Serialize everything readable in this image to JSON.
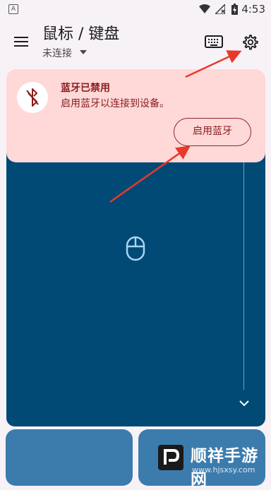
{
  "status_bar": {
    "app_badge": "A",
    "time": "4:53"
  },
  "app_bar": {
    "title": "鼠标 / 键盘",
    "subtitle": "未连接",
    "icons": [
      "menu-icon",
      "keyboard-icon",
      "gear-icon"
    ]
  },
  "banner": {
    "title": "蓝牙已禁用",
    "description": "启用蓝牙以连接到设备。",
    "enable_button": "启用蓝牙",
    "icon": "bluetooth-disabled-icon"
  },
  "touchpad": {
    "icon": "mouse-icon",
    "scroll_icon": "chevron-down-icon"
  },
  "colors": {
    "touchpad": "#004a75",
    "buttons": "#3b7cad",
    "banner": "#ffd8d8",
    "annotation": "#e8392b"
  },
  "watermark": {
    "text": "顺祥手游网",
    "url": "www.hjsxsy.com"
  }
}
